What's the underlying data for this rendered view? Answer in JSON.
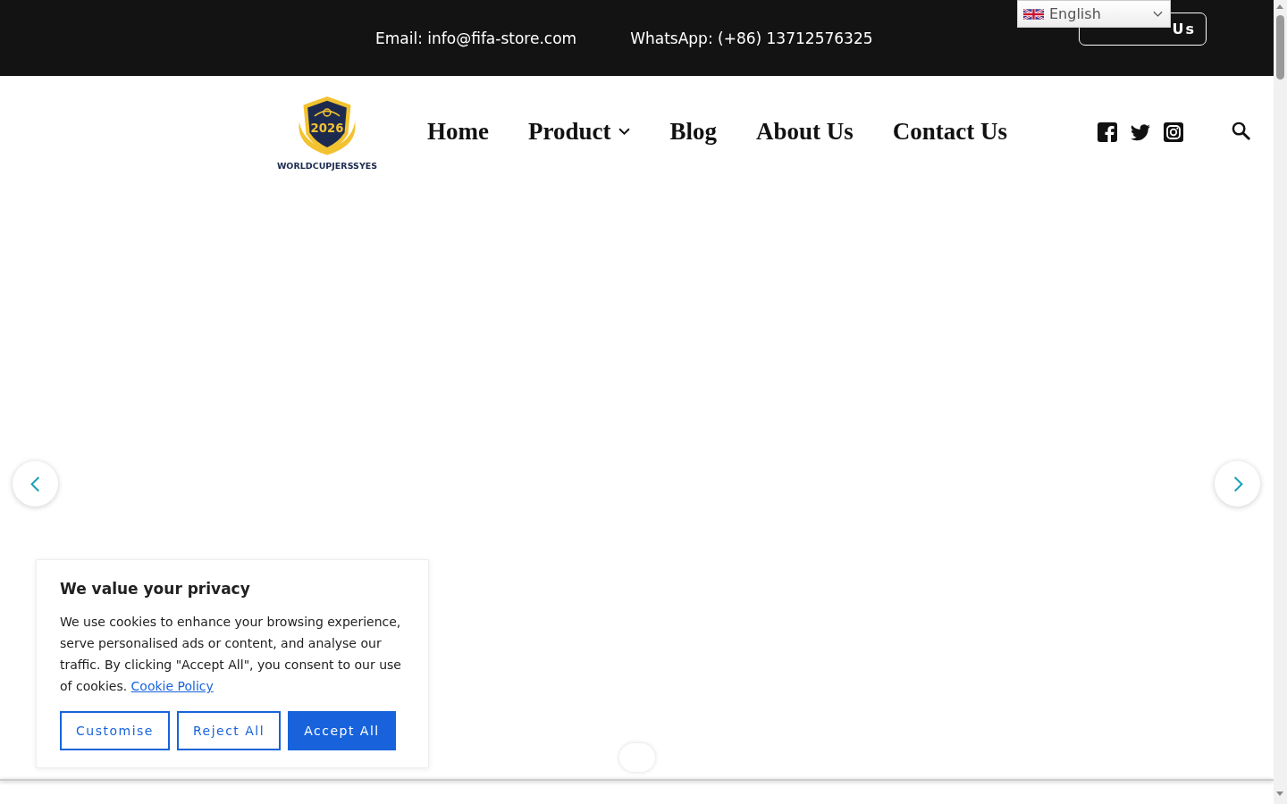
{
  "top_bar": {
    "email": "Email: info@fifa-store.com",
    "whatsapp": "WhatsApp: (+86) 13712576325",
    "contact_button": "Us"
  },
  "language_select": {
    "value": "English"
  },
  "logo": {
    "year": "2026",
    "name": "WORLDCUPJERSSYES"
  },
  "nav": [
    {
      "label": "Home",
      "has_submenu": false
    },
    {
      "label": "Product",
      "has_submenu": true
    },
    {
      "label": "Blog",
      "has_submenu": false
    },
    {
      "label": "About Us",
      "has_submenu": false
    },
    {
      "label": "Contact Us",
      "has_submenu": false
    }
  ],
  "social": [
    {
      "kind": "facebook"
    },
    {
      "kind": "twitter"
    },
    {
      "kind": "instagram"
    }
  ],
  "cookie_banner": {
    "title": "We value your privacy",
    "text": "We use cookies to enhance your browsing experience, serve personalised ads or content, and analyse our traffic. By clicking \"Accept All\", you consent to our use of cookies.",
    "link": "Cookie Policy",
    "buttons": [
      {
        "label": "Customise",
        "kind": "outline"
      },
      {
        "label": "Reject All",
        "kind": "outline"
      },
      {
        "label": "Accept All",
        "kind": "primary"
      }
    ]
  }
}
